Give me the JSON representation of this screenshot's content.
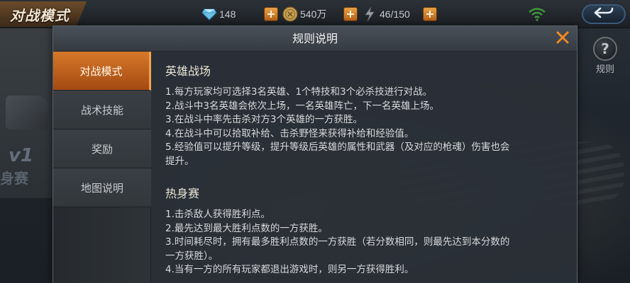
{
  "topbar": {
    "title": "对战模式",
    "diamonds": "148",
    "gold": "540万",
    "energy": "46/150",
    "plus_label": "+"
  },
  "side": {
    "rule_icon_glyph": "?",
    "rule_label": "规则"
  },
  "background": {
    "v1_text": "v1",
    "sai_text": "身赛"
  },
  "modal": {
    "title": "规则说明",
    "tabs": [
      {
        "label": "对战模式",
        "active": true
      },
      {
        "label": "战术技能",
        "active": false
      },
      {
        "label": "奖励",
        "active": false
      },
      {
        "label": "地图说明",
        "active": false
      }
    ],
    "sections": [
      {
        "title": "英雄战场",
        "rules": [
          "1.每方玩家均可选择3名英雄、1个特技和3个必杀技进行对战。",
          "2.战斗中3名英雄会依次上场，一名英雄阵亡，下一名英雄上场。",
          "3.在战斗中率先击杀对方3个英雄的一方获胜。",
          "4.在战斗中可以拾取补给、击杀野怪来获得补给和经验值。",
          "5.经验值可以提升等级，提升等级后英雄的属性和武器（及对应的枪魂）伤害也会",
          "提升。"
        ]
      },
      {
        "title": "热身赛",
        "rules": [
          "1.击杀敌人获得胜利点。",
          "2.最先达到最大胜利点数的一方获胜。",
          "3.时间耗尽时，拥有最多胜利点数的一方获胜（若分数相同，则最先达到本分数的",
          "一方获胜）。",
          "4.当有一方的所有玩家都退出游戏时，则另一方获得胜利。"
        ]
      }
    ]
  },
  "colors": {
    "accent_orange": "#d6792a",
    "modal_bg": "#2b3037",
    "close_orange": "#f08a24"
  },
  "icons": [
    "diamond-icon",
    "gold-coin-icon",
    "energy-bolt-icon",
    "wifi-icon",
    "back-arrow-icon",
    "close-icon",
    "help-icon"
  ]
}
